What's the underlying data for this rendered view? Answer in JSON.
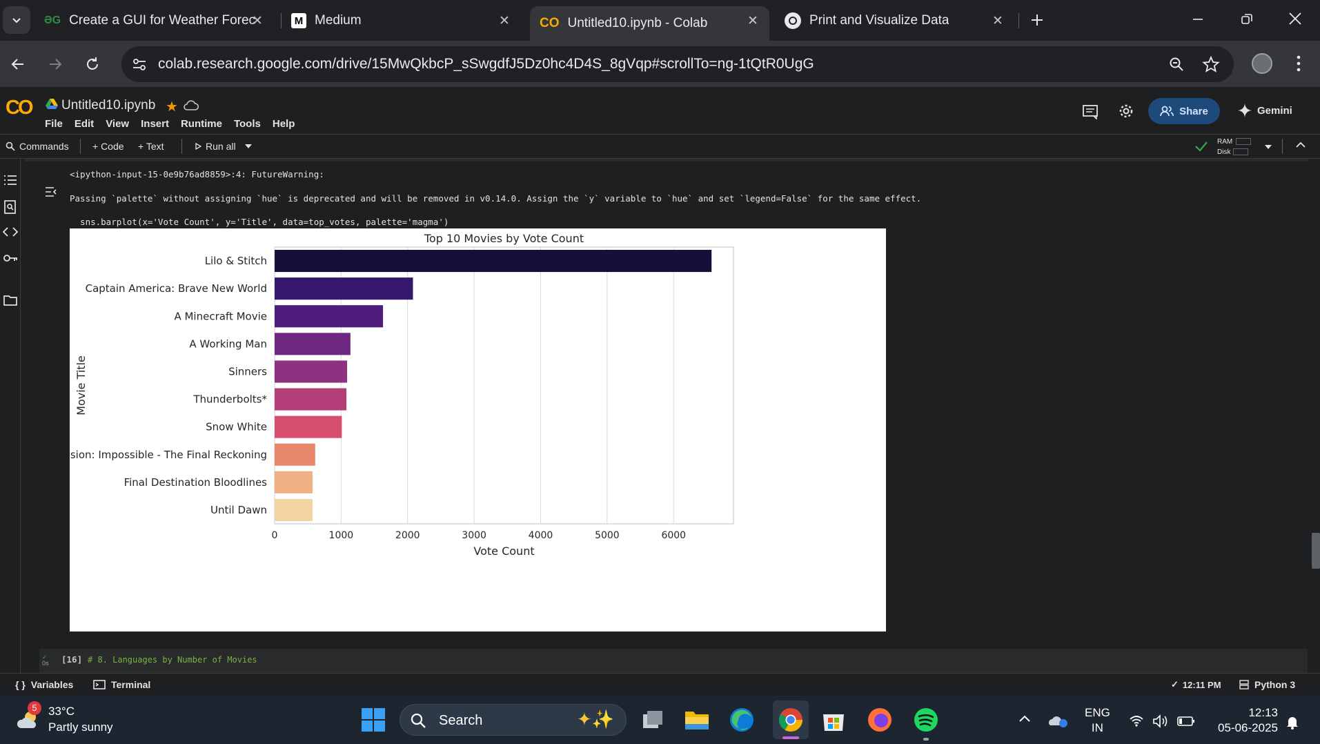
{
  "browser": {
    "tabs": [
      {
        "title": "Create a GUI for Weather Forec",
        "icon": "geeksforgeeks-icon"
      },
      {
        "title": "Medium",
        "icon": "medium-icon"
      },
      {
        "title": "Untitled10.ipynb - Colab",
        "icon": "colab-icon"
      },
      {
        "title": "Print and Visualize Data",
        "icon": "chatgpt-icon"
      }
    ],
    "url": "colab.research.google.com/drive/15MwQkbcP_sSwgdfJ5Dz0hc4D4S_8gVqp#scrollTo=ng-1tQtR0UgG"
  },
  "colab": {
    "filename": "Untitled10.ipynb",
    "menu": [
      "File",
      "Edit",
      "View",
      "Insert",
      "Runtime",
      "Tools",
      "Help"
    ],
    "share_label": "Share",
    "gemini_label": "Gemini",
    "commands_label": "Commands",
    "code_label": "+ Code",
    "text_label": "+ Text",
    "runall_label": "Run all",
    "ram_label": "RAM",
    "disk_label": "Disk"
  },
  "cell_output": {
    "warn_line1": "<ipython-input-15-0e9b76ad8859>:4: FutureWarning:",
    "warn_line2": "Passing `palette` without assigning `hue` is deprecated and will be removed in v0.14.0. Assign the `y` variable to `hue` and set `legend=False` for the same effect.",
    "code_line": "  sns.barplot(x='Vote Count', y='Title', data=top_votes, palette='magma')"
  },
  "next_cell": {
    "exec_count": "[16]",
    "comment": "# 8. Languages by Number of Movies",
    "run_time": "0s"
  },
  "chart_data": {
    "type": "bar",
    "orientation": "horizontal",
    "title": "Top 10 Movies by Vote Count",
    "xlabel": "Vote Count",
    "ylabel": "Movie Title",
    "categories": [
      "Lilo & Stitch",
      "Captain America: Brave New World",
      "A Minecraft Movie",
      "A Working Man",
      "Sinners",
      "Thunderbolts*",
      "Snow White",
      "Mission: Impossible - The Final Reckoning",
      "Final Destination Bloodlines",
      "Until Dawn"
    ],
    "values": [
      6570,
      2080,
      1630,
      1140,
      1090,
      1080,
      1010,
      610,
      570,
      570
    ],
    "colors": [
      "#160f3b",
      "#35186b",
      "#4e1d7b",
      "#6e2781",
      "#8c3281",
      "#b43e78",
      "#d74f6d",
      "#e8876a",
      "#f0b083",
      "#f3d4a4"
    ],
    "xticks": [
      "0",
      "1000",
      "2000",
      "3000",
      "4000",
      "5000",
      "6000"
    ],
    "xlim": [
      0,
      6900
    ],
    "grid": "vertical"
  },
  "statusbar": {
    "variables_label": "Variables",
    "terminal_label": "Terminal",
    "time": "12:11 PM",
    "runtime": "Python 3"
  },
  "taskbar": {
    "weather_temp": "33°C",
    "weather_desc": "Partly sunny",
    "weather_badge": "5",
    "search_label": "Search",
    "lang1": "ENG",
    "lang2": "IN",
    "clock_time": "12:13",
    "clock_date": "05-06-2025"
  }
}
